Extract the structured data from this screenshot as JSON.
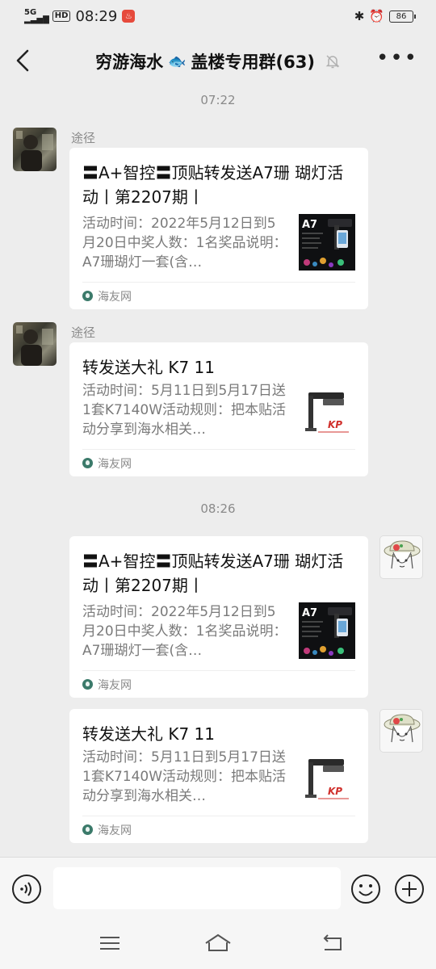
{
  "status_bar": {
    "network": "5G",
    "hd_label": "HD",
    "time": "08:29",
    "battery": "86"
  },
  "header": {
    "title_before": "穷游海水",
    "title_emoji": "🐟",
    "title_after": "盖楼专用群(63)"
  },
  "timestamps": [
    "07:22",
    "08:26"
  ],
  "messages": [
    {
      "sender": "途径",
      "title": "〓A+智控〓顶贴转发送A7珊 瑚灯活动丨第2207期丨",
      "desc": "活动时间：2022年5月12日到5月20日中奖人数：1名奖品说明：A7珊瑚灯一套(含…",
      "source": "海友网",
      "thumb_text": "A7"
    },
    {
      "sender": "途径",
      "title": "转发送大礼 K7 11",
      "desc": "活动时间：5月11日到5月17日送1套K7140W活动规则：把本贴活动分享到海水相关…",
      "source": "海友网",
      "thumb_text": "KP"
    },
    {
      "sender": "",
      "title": "〓A+智控〓顶贴转发送A7珊 瑚灯活动丨第2207期丨",
      "desc": "活动时间：2022年5月12日到5月20日中奖人数：1名奖品说明：A7珊瑚灯一套(含…",
      "source": "海友网",
      "thumb_text": "A7"
    },
    {
      "sender": "",
      "title": "转发送大礼 K7 11",
      "desc": "活动时间：5月11日到5月17日送1套K7140W活动规则：把本贴活动分享到海水相关…",
      "source": "海友网",
      "thumb_text": "KP"
    }
  ],
  "input": {
    "placeholder": ""
  }
}
